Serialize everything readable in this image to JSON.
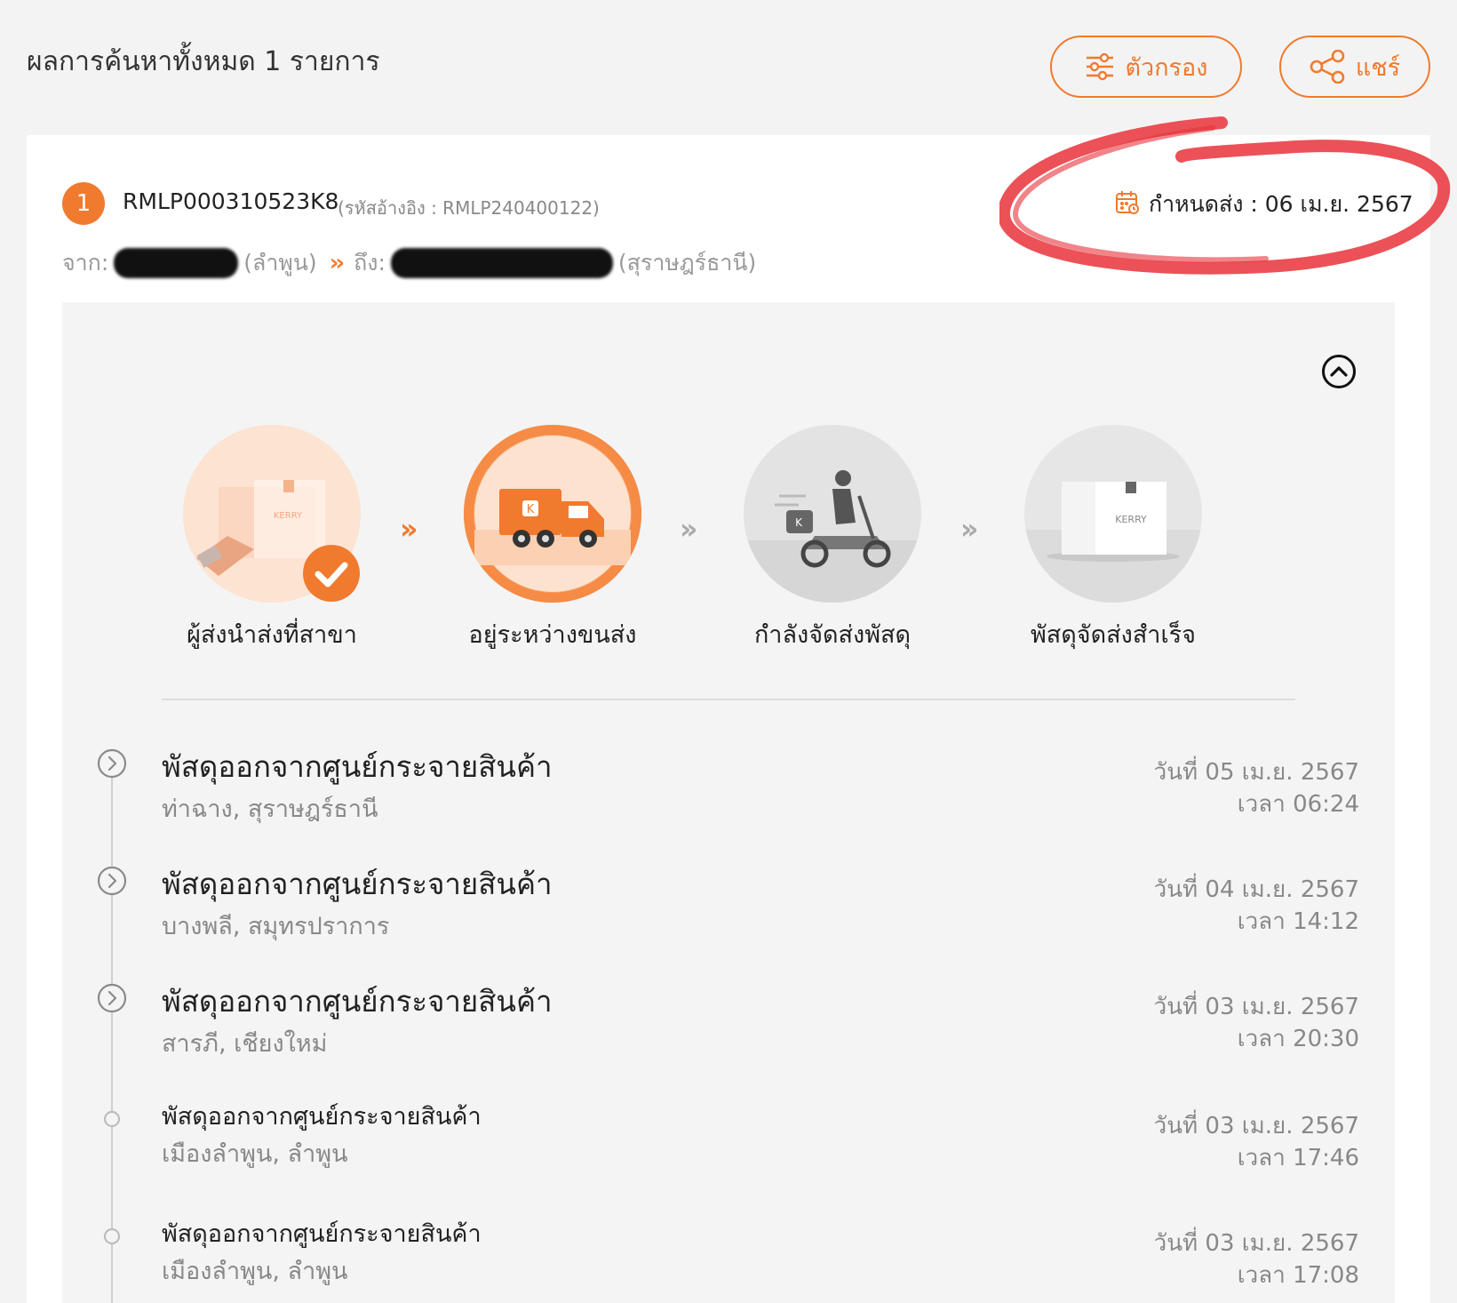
{
  "header": {
    "results_title": "ผลการค้นหาทั้งหมด 1 รายการ",
    "filter_label": "ตัวกรอง",
    "share_label": "แชร์"
  },
  "shipment": {
    "index": "1",
    "tracking_number": "RMLP000310523K8",
    "reference": "(รหัสอ้างอิง : RMLP240400122)",
    "due_date_label": "กำหนดส่ง : 06 เม.ย. 2567",
    "from_label": "จาก:",
    "from_province": "(ลำพูน)",
    "to_label": "ถึง:",
    "to_province": "(สุราษฎร์ธานี)"
  },
  "steps": [
    {
      "label": "ผู้ส่งนำส่งที่สาขา",
      "state": "done"
    },
    {
      "label": "อยู่ระหว่างขนส่ง",
      "state": "current"
    },
    {
      "label": "กำลังจัดส่งพัสดุ",
      "state": "pending"
    },
    {
      "label": "พัสดุจัดส่งสำเร็จ",
      "state": "pending"
    }
  ],
  "timeline": [
    {
      "title": "พัสดุออกจากศูนย์กระจายสินค้า",
      "location": "ท่าฉาง, สุราษฎร์ธานี",
      "date": "วันที่ 05 เม.ย. 2567",
      "time": "เวลา 06:24"
    },
    {
      "title": "พัสดุออกจากศูนย์กระจายสินค้า",
      "location": "บางพลี, สมุทรปราการ",
      "date": "วันที่ 04 เม.ย. 2567",
      "time": "เวลา 14:12"
    },
    {
      "title": "พัสดุออกจากศูนย์กระจายสินค้า",
      "location": "สารภี, เชียงใหม่",
      "date": "วันที่ 03 เม.ย. 2567",
      "time": "เวลา 20:30"
    },
    {
      "title": "พัสดุออกจากศูนย์กระจายสินค้า",
      "location": "เมืองลำพูน, ลำพูน",
      "date": "วันที่ 03 เม.ย. 2567",
      "time": "เวลา 17:46"
    },
    {
      "title": "พัสดุออกจากศูนย์กระจายสินค้า",
      "location": "เมืองลำพูน, ลำพูน",
      "date": "วันที่ 03 เม.ย. 2567",
      "time": "เวลา 17:08"
    }
  ],
  "colors": {
    "accent": "#f07a2e",
    "annotation": "#e8323a"
  },
  "icons": [
    "filter-icon",
    "share-icon",
    "calendar-icon",
    "chevron-up-icon",
    "check-icon",
    "chevron-right-circle-icon"
  ]
}
